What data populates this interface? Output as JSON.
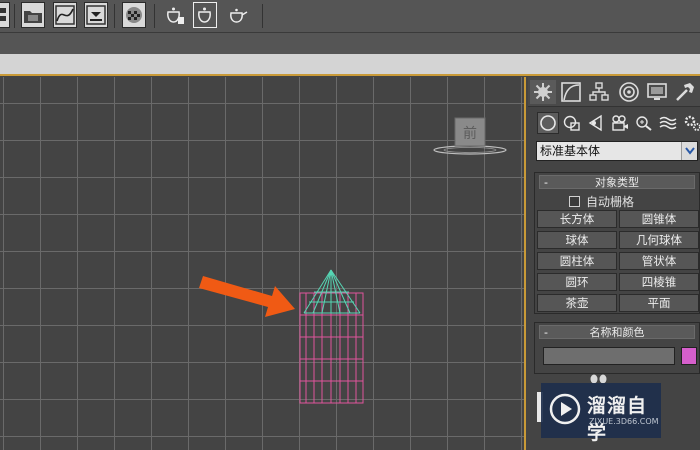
{
  "viewport": {
    "viewcube_label": "前"
  },
  "command_panel": {
    "category_value": "标准基本体",
    "object_type": {
      "title": "对象类型",
      "minus": "-",
      "autogrid_label": "自动栅格",
      "primitives": [
        {
          "label": "长方体"
        },
        {
          "label": "圆锥体"
        },
        {
          "label": "球体"
        },
        {
          "label": "几何球体"
        },
        {
          "label": "圆柱体"
        },
        {
          "label": "管状体"
        },
        {
          "label": "圆环"
        },
        {
          "label": "四棱锥"
        },
        {
          "label": "茶壶"
        },
        {
          "label": "平面"
        }
      ]
    },
    "name_color": {
      "title": "名称和颜色",
      "minus": "-",
      "name_value": "",
      "color": "#d65fcc"
    }
  },
  "scene": {
    "cylinder_color": "#e0559c",
    "cone_color": "#56d6b4",
    "arrow_color": "#f05a14"
  },
  "watermark": {
    "title": "溜溜自学",
    "subtitle": "ZIXUE.3D66.COM"
  },
  "icons": {
    "toolbar": [
      "schematic-view-icon",
      "material-editor-icon",
      "curve-editor-icon",
      "render-setup-icon",
      "rendered-frame-icon",
      "render-icon",
      "render-production-icon",
      "render-iterative-icon"
    ],
    "panel_tabs": [
      "create-icon",
      "modify-icon",
      "hierarchy-icon",
      "motion-icon",
      "display-icon",
      "utilities-icon"
    ],
    "sub_tabs": [
      "geometry-icon",
      "shapes-icon",
      "lights-icon",
      "cameras-icon",
      "helpers-icon",
      "spacewarps-icon",
      "systems-icon"
    ]
  }
}
